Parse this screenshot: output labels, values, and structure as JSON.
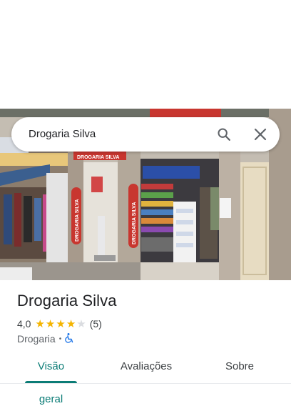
{
  "search": {
    "query": "Drogaria Silva"
  },
  "icons": {
    "search": "search-icon",
    "close": "close-icon",
    "wheelchair": "wheelchair-accessible-icon"
  },
  "place": {
    "name": "Drogaria Silva",
    "rating": "4,0",
    "rating_value": 4.0,
    "review_count": "(5)",
    "category": "Drogaria",
    "separator": "•"
  },
  "photo": {
    "store_sign": "DROGARIA SILVA",
    "side_banner_left": "DROGARIA SILVA",
    "side_banner_right": "DROGARIA SILVA"
  },
  "tabs": [
    {
      "label": "Visão geral",
      "active": true
    },
    {
      "label": "Avaliações",
      "active": false
    },
    {
      "label": "Sobre",
      "active": false
    }
  ],
  "colors": {
    "accent": "#0b7c76",
    "star": "#f4b400",
    "wheelchair": "#1a73e8"
  }
}
